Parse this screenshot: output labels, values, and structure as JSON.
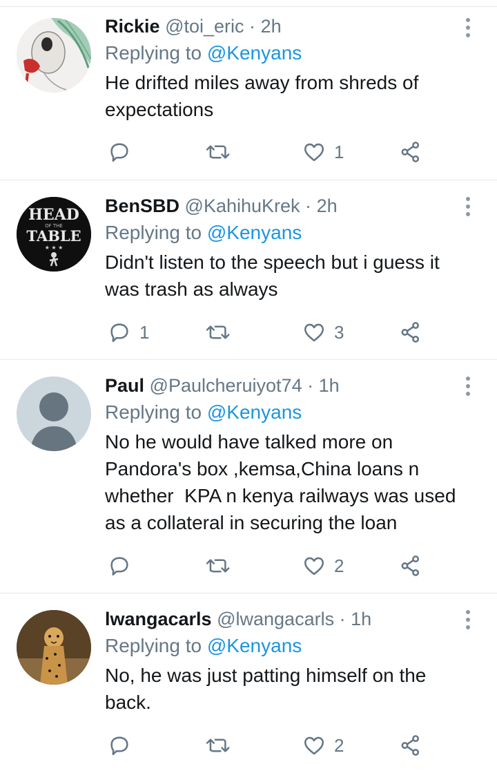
{
  "tweets": [
    {
      "name": "Rickie",
      "handle": "@toi_eric",
      "sep": "·",
      "time": "2h",
      "replying_prefix": "Replying to ",
      "replying_to": "@Kenyans",
      "text": "He drifted miles away from shreds of\nexpectations",
      "replies": "",
      "retweets": "",
      "likes": "1"
    },
    {
      "name": "BenSBD",
      "handle": "@KahihuKrek",
      "sep": "·",
      "time": "2h",
      "replying_prefix": "Replying to ",
      "replying_to": "@Kenyans",
      "text": "Didn't listen to the speech but i guess it\nwas trash as always",
      "replies": "1",
      "retweets": "",
      "likes": "3",
      "avatar_text": {
        "line1": "HEAD",
        "line2": "OF THE",
        "line3": "TABLE",
        "line4": "★ ★ ★"
      }
    },
    {
      "name": "Paul",
      "handle": "@Paulcheruiyot74",
      "sep": "·",
      "time": "1h",
      "replying_prefix": "Replying to ",
      "replying_to": "@Kenyans",
      "text": "No he would have talked more on\nPandora's box ,kemsa,China loans n\nwhether  KPA n kenya railways was used\nas a collateral in securing the loan",
      "replies": "",
      "retweets": "",
      "likes": "2"
    },
    {
      "name": "lwangacarls",
      "handle": "@lwangacarls",
      "sep": "·",
      "time": "1h",
      "replying_prefix": "Replying to ",
      "replying_to": "@Kenyans",
      "text": "No, he was just patting himself on the\nback.",
      "replies": "",
      "retweets": "",
      "likes": "2"
    }
  ],
  "colors": {
    "text": "#14171a",
    "secondary": "#657786",
    "link": "#1b95e0",
    "icon": "#657786",
    "divider": "#e1e8ed"
  },
  "icons": {
    "reply": "reply-icon",
    "retweet": "retweet-icon",
    "like": "heart-icon",
    "share": "share-icon",
    "more": "more-vertical-icon"
  }
}
